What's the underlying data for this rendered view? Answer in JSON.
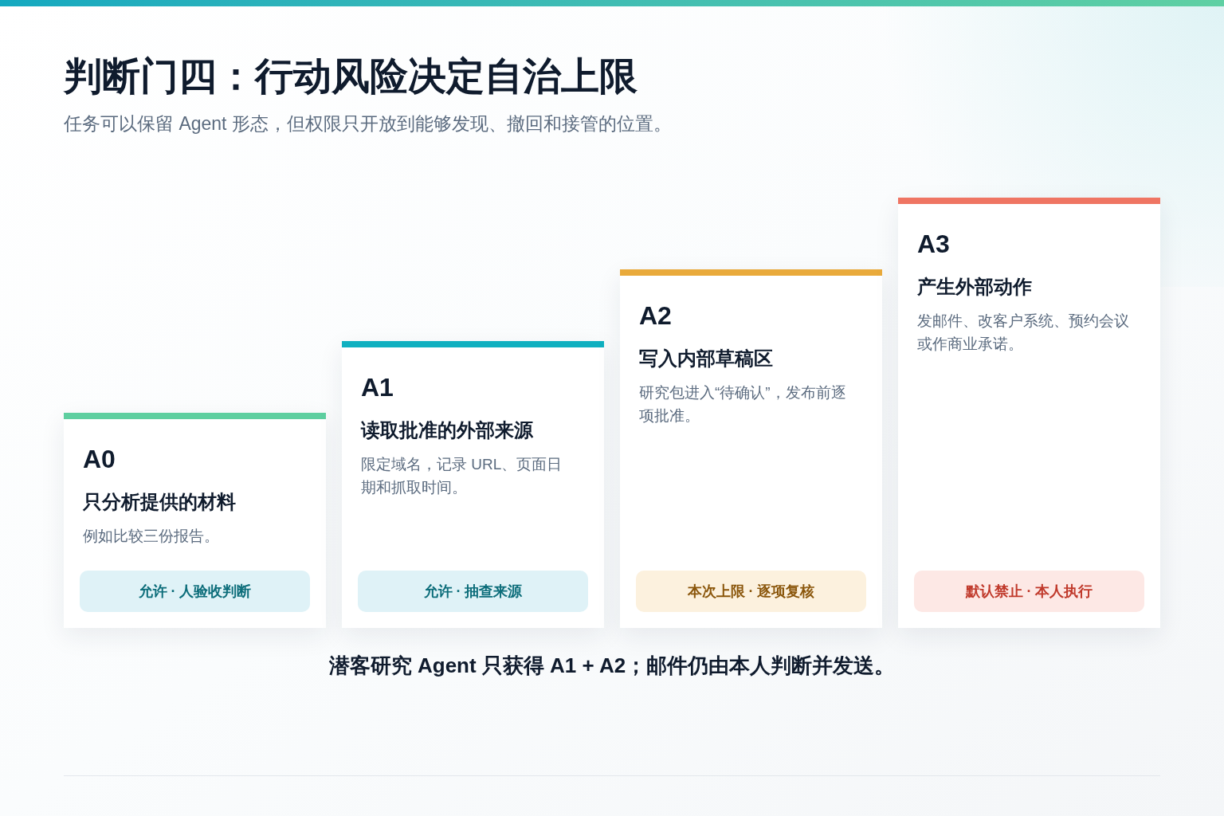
{
  "title": "判断门四：行动风险决定自治上限",
  "subtitle": "任务可以保留 Agent 形态，但权限只开放到能够发现、撤回和接管的位置。",
  "levels": [
    {
      "code": "A0",
      "heading": "只分析提供的材料",
      "description": "例如比较三份报告。",
      "color": "#5ecfa0",
      "badge": {
        "kind": "allow",
        "label": "允许 · 人验收判断"
      }
    },
    {
      "code": "A1",
      "heading": "读取批准的外部来源",
      "description": "限定域名，记录 URL、页面日期和抓取时间。",
      "color": "#0fb0c0",
      "badge": {
        "kind": "allow",
        "label": "允许 · 抽查来源"
      }
    },
    {
      "code": "A2",
      "heading": "写入内部草稿区",
      "description": "研究包进入“待确认”，发布前逐项批准。",
      "color": "#e9aa3b",
      "badge": {
        "kind": "limit",
        "label": "本次上限 · 逐项复核"
      }
    },
    {
      "code": "A3",
      "heading": "产生外部动作",
      "description": "发邮件、改客户系统、预约会议或作商业承诺。",
      "color": "#ef7563",
      "badge": {
        "kind": "deny",
        "label": "默认禁止 · 本人执行"
      }
    }
  ],
  "conclusion": "潜客研究 Agent 只获得 A1 + A2；邮件仍由本人判断并发送。"
}
